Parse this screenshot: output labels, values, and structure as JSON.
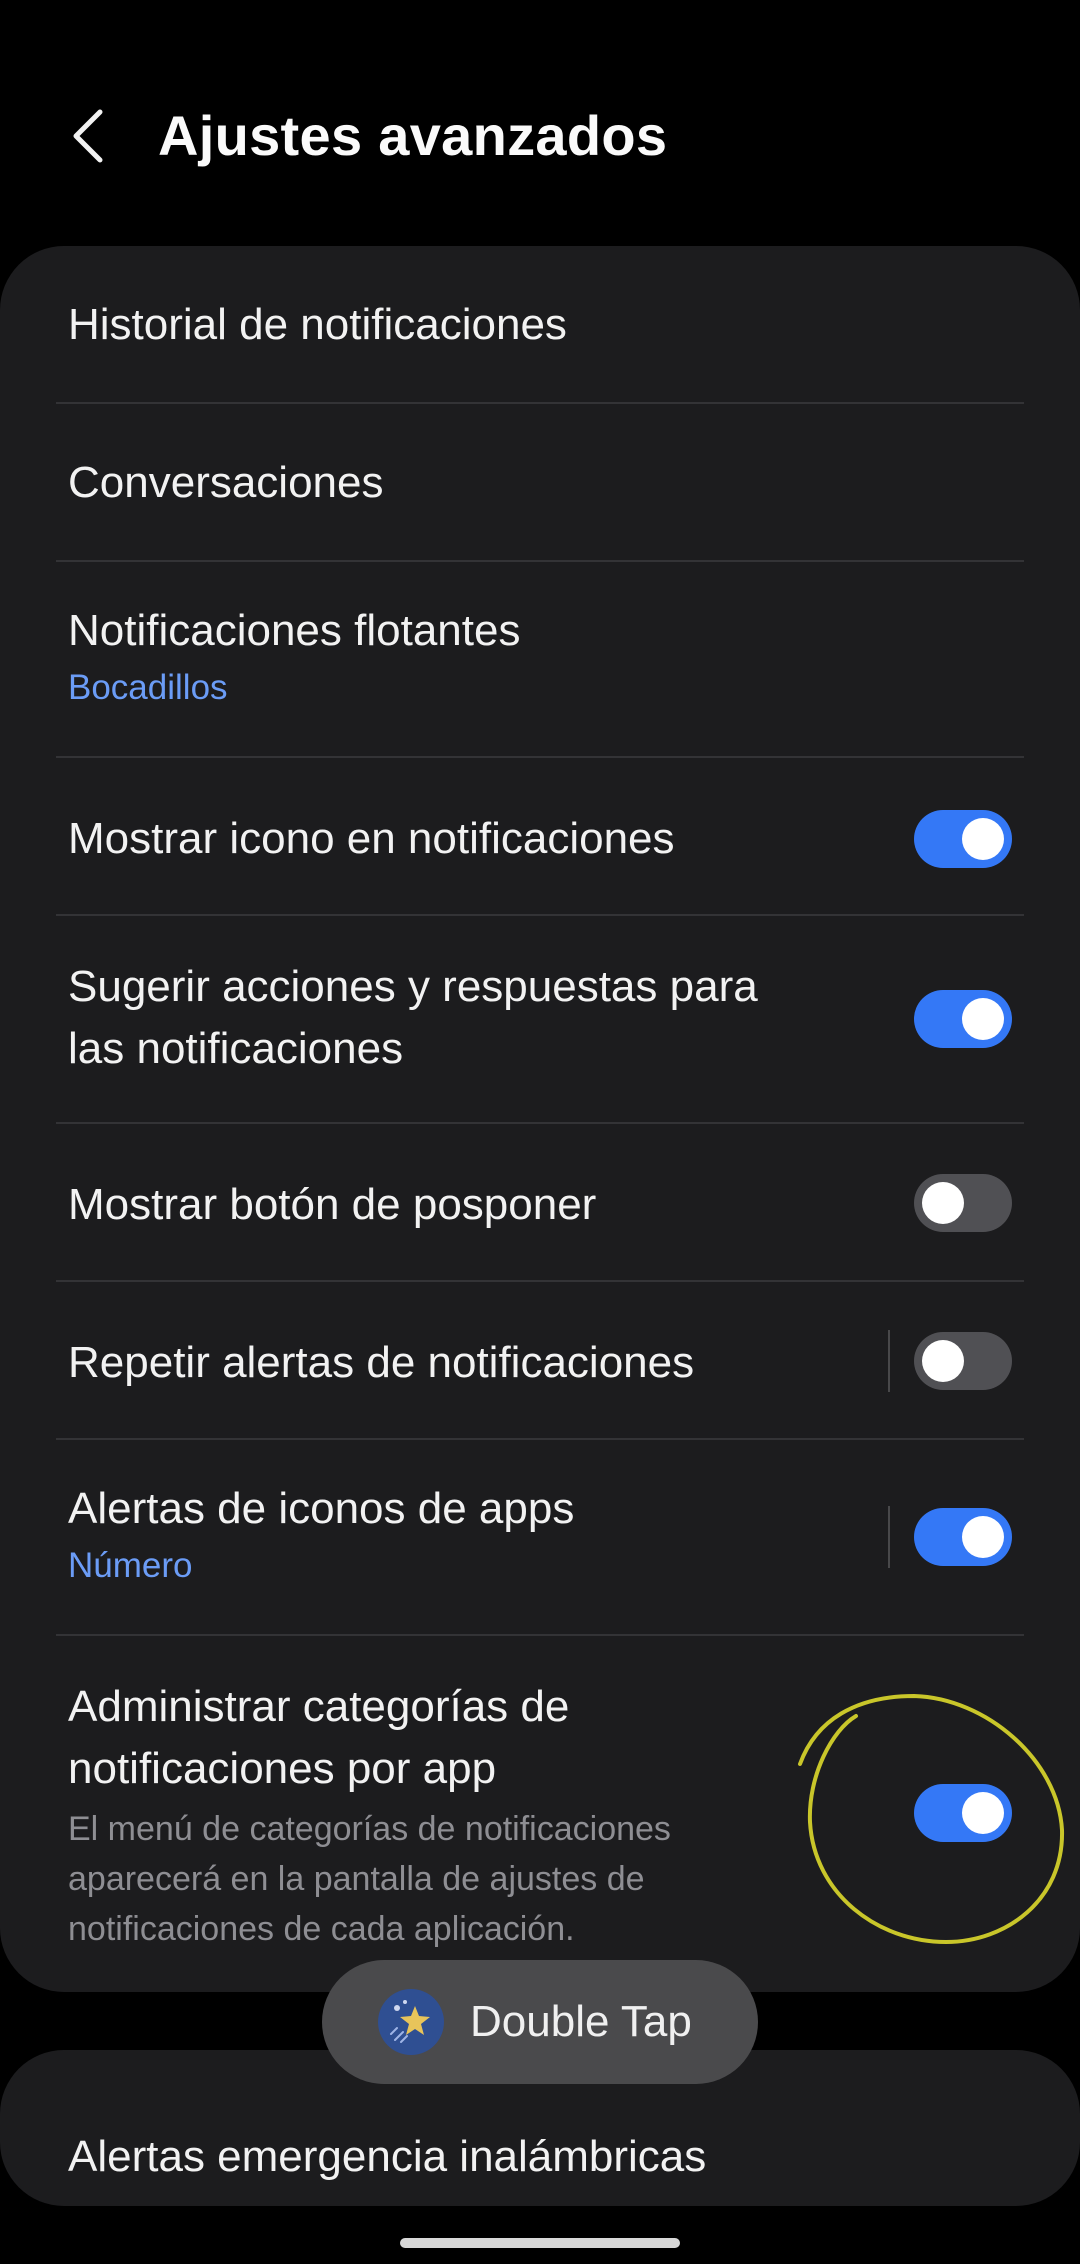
{
  "header": {
    "title": "Ajustes avanzados",
    "back_icon": "chevron-left-icon"
  },
  "settings": [
    {
      "id": "historial",
      "title": "Historial de notificaciones"
    },
    {
      "id": "conversaciones",
      "title": "Conversaciones"
    },
    {
      "id": "flotantes",
      "title": "Notificaciones flotantes",
      "subtitle": "Bocadillos"
    },
    {
      "id": "mostrar-icono",
      "title": "Mostrar icono en notificaciones",
      "toggle": true
    },
    {
      "id": "sugerir",
      "title_line1": "Sugerir acciones y respuestas para",
      "title_line2": "las notificaciones",
      "toggle": true
    },
    {
      "id": "posponer",
      "title": "Mostrar botón de posponer",
      "toggle": false
    },
    {
      "id": "repetir",
      "title": "Repetir alertas de notificaciones",
      "toggle": false
    },
    {
      "id": "iconos-apps",
      "title": "Alertas de iconos de apps",
      "subtitle": "Número",
      "toggle": true
    },
    {
      "id": "categorias",
      "title_line1": "Administrar categorías de",
      "title_line2": "notificaciones por app",
      "desc_line1": "El menú de categorías de notificaciones",
      "desc_line2": "aparecerá en la pantalla de ajustes de",
      "desc_line3": "notificaciones de cada aplicación.",
      "toggle": true
    }
  ],
  "bottom_item": {
    "title": "Alertas emergencia inalámbricas"
  },
  "toast": {
    "label": "Double Tap",
    "icon": "double-tap-star-icon"
  },
  "colors": {
    "background": "#000000",
    "card": "#1c1c1e",
    "accent": "#3478f6",
    "link": "#6b9cf6",
    "annotation": "#c9c62a"
  }
}
